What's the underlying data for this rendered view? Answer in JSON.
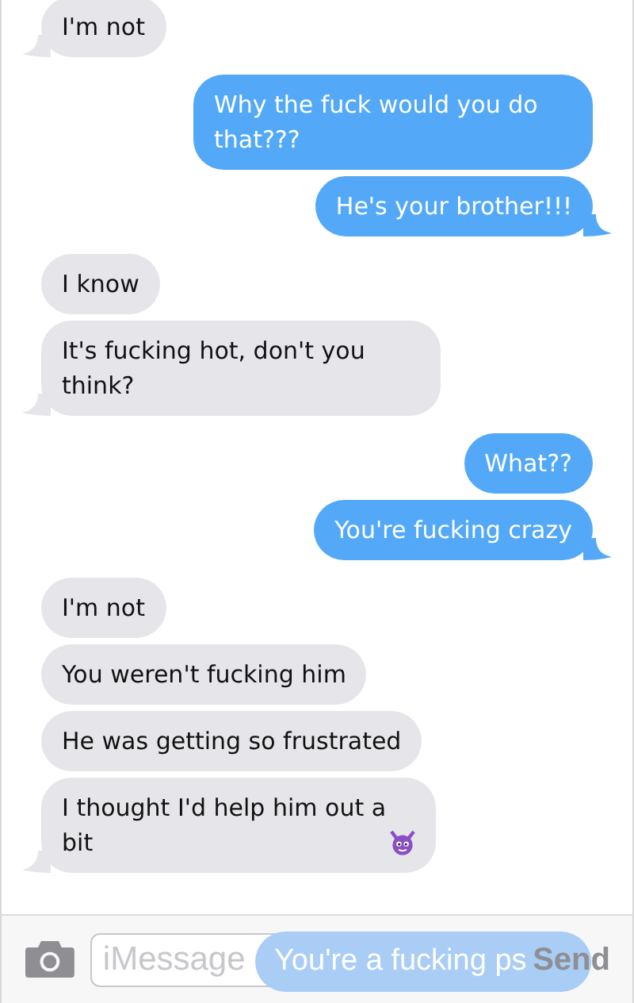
{
  "messages": [
    {
      "kind": "received",
      "text": "I'm not",
      "tail": true
    },
    {
      "kind": "sent",
      "text": "Why the fuck would you do that???",
      "tail": false
    },
    {
      "kind": "sent",
      "text": "He's your brother!!!",
      "tail": true
    },
    {
      "kind": "received",
      "text": "I know",
      "tail": false
    },
    {
      "kind": "received",
      "text": "It's fucking hot, don't you think?",
      "tail": true
    },
    {
      "kind": "sent",
      "text": "What??",
      "tail": false
    },
    {
      "kind": "sent",
      "text": "You're fucking crazy",
      "tail": true
    },
    {
      "kind": "received",
      "text": "I'm not",
      "tail": false
    },
    {
      "kind": "received",
      "text": "You weren't fucking him",
      "tail": false
    },
    {
      "kind": "received",
      "text": "He was getting so frustrated",
      "tail": false
    },
    {
      "kind": "received",
      "text": "I thought I'd help him out a bit",
      "tail": true,
      "icon": true
    }
  ],
  "composer": {
    "placeholder": "iMessage",
    "sending_text": "You're a fucking ps",
    "send_label": "Send"
  }
}
